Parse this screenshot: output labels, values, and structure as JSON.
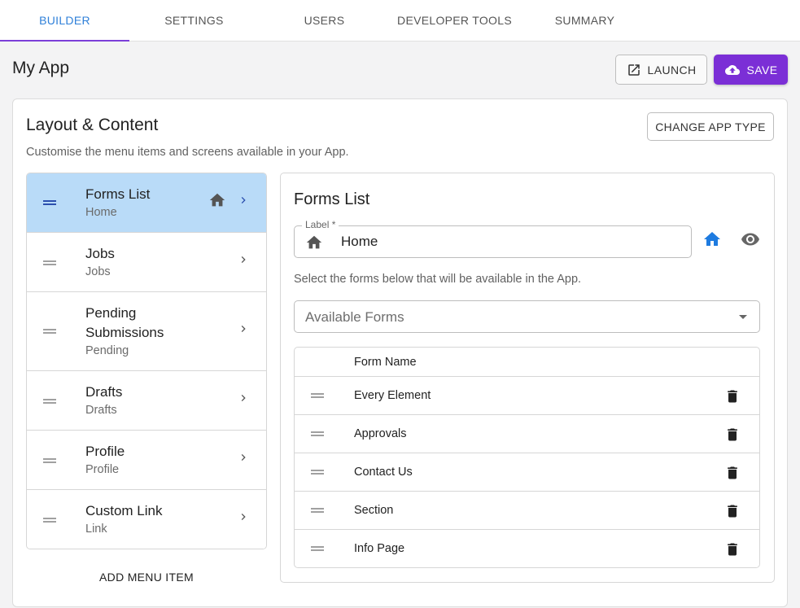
{
  "tabs": [
    {
      "label": "BUILDER",
      "active": true
    },
    {
      "label": "SETTINGS",
      "active": false
    },
    {
      "label": "USERS",
      "active": false
    },
    {
      "label": "DEVELOPER TOOLS",
      "active": false
    },
    {
      "label": "SUMMARY",
      "active": false
    }
  ],
  "header": {
    "title": "My App",
    "launch_label": "LAUNCH",
    "save_label": "SAVE"
  },
  "card": {
    "title": "Layout & Content",
    "subtitle": "Customise the menu items and screens available in your App.",
    "change_app_type_label": "CHANGE APP TYPE",
    "add_menu_item_label": "ADD MENU ITEM"
  },
  "menu_items": [
    {
      "label": "Forms List",
      "sublabel": "Home",
      "selected": true,
      "is_home": true
    },
    {
      "label": "Jobs",
      "sublabel": "Jobs",
      "selected": false
    },
    {
      "label": "Pending Submissions",
      "sublabel": "Pending",
      "selected": false
    },
    {
      "label": "Drafts",
      "sublabel": "Drafts",
      "selected": false
    },
    {
      "label": "Profile",
      "sublabel": "Profile",
      "selected": false
    },
    {
      "label": "Custom Link",
      "sublabel": "Link",
      "selected": false
    }
  ],
  "detail": {
    "title": "Forms List",
    "label_field": {
      "legend": "Label *",
      "value": "Home"
    },
    "hint": "Select the forms below that will be available in the App.",
    "available_forms_placeholder": "Available Forms",
    "table_header": "Form Name",
    "forms": [
      "Every Element",
      "Approvals",
      "Contact Us",
      "Section",
      "Info Page"
    ]
  },
  "colors": {
    "accent": "#7b2fd6",
    "tab_active_text": "#2f80d9",
    "selected_row": "#b9dbf8",
    "home_icon_blue": "#1e7be0"
  },
  "icons": {
    "launch": "open-in-new-icon",
    "save": "cloud-upload-icon",
    "home": "home-icon",
    "chevron": "chevron-right-icon",
    "visibility": "eye-icon",
    "delete": "trash-icon",
    "drag": "drag-handle-icon"
  }
}
